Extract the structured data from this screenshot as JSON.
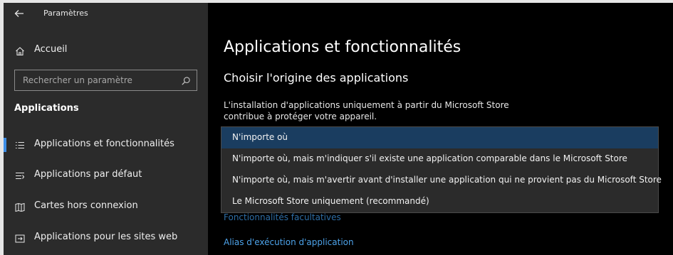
{
  "window": {
    "title": "Paramètres"
  },
  "sidebar": {
    "home_label": "Accueil",
    "search_placeholder": "Rechercher un paramètre",
    "section_title": "Applications",
    "items": [
      {
        "label": "Applications et fonctionnalités",
        "icon": "apps-features-icon",
        "selected": true
      },
      {
        "label": "Applications par défaut",
        "icon": "default-apps-icon",
        "selected": false
      },
      {
        "label": "Cartes hors connexion",
        "icon": "offline-maps-icon",
        "selected": false
      },
      {
        "label": "Applications pour les sites web",
        "icon": "apps-websites-icon",
        "selected": false
      }
    ]
  },
  "main": {
    "title": "Applications et fonctionnalités",
    "subtitle": "Choisir l'origine des applications",
    "description_line1": "L'installation d'applications uniquement à partir du Microsoft Store",
    "description_line2": "contribue à protéger votre appareil.",
    "dropdown_options": [
      "N'importe où",
      "N'importe où, mais m'indiquer s'il existe une application comparable dans le Microsoft Store",
      "N'importe où, mais m'avertir avant d'installer une application qui ne provient pas du Microsoft Store",
      "Le Microsoft Store uniquement (recommandé)"
    ],
    "selected_option_index": 0,
    "links": {
      "optional_features": "Fonctionnalités facultatives",
      "app_execution_alias": "Alias d'exécution d'application"
    }
  },
  "colors": {
    "accent": "#3d8ee6",
    "link": "#4da3ea",
    "sidebar_bg": "#2b2b2b",
    "highlight": "#1a3d60"
  }
}
